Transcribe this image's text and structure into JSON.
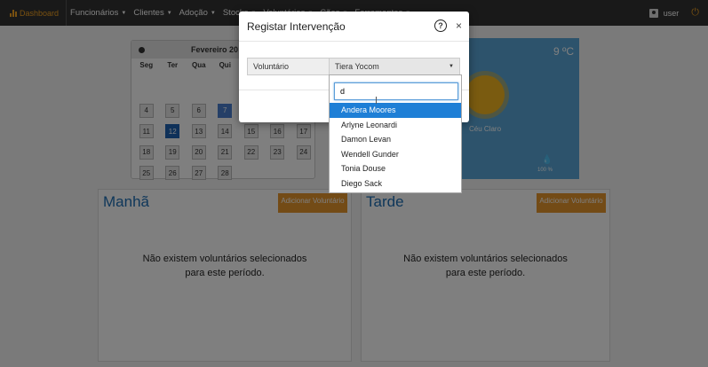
{
  "navbar": {
    "brand": "Dashboard",
    "items": [
      {
        "label": "Funcionários"
      },
      {
        "label": "Clientes"
      },
      {
        "label": "Adoção"
      },
      {
        "label": "Stocks"
      },
      {
        "label": "Voluntários"
      },
      {
        "label": "Cães"
      },
      {
        "label": "Ferramentas"
      }
    ],
    "user": "user"
  },
  "calendar": {
    "month": "Fevereiro 20",
    "weekdays": [
      "Seg",
      "Ter",
      "Qua",
      "Qui",
      "",
      "",
      ""
    ],
    "weeks": [
      [
        "4",
        "5",
        "6",
        "7",
        "",
        "",
        ""
      ],
      [
        "11",
        "12",
        "13",
        "14",
        "15",
        "16",
        "17"
      ],
      [
        "18",
        "19",
        "20",
        "21",
        "22",
        "23",
        "24"
      ],
      [
        "25",
        "26",
        "27",
        "28",
        "",
        "",
        ""
      ]
    ]
  },
  "weather": {
    "temp": "9 ºC",
    "desc": "Céu Claro",
    "humidity": "100 %"
  },
  "panels": {
    "morning": {
      "title": "Manhã",
      "button": "Adicionar Voluntário",
      "empty_line1": "Não existem voluntários selecionados",
      "empty_line2": "para este período."
    },
    "afternoon": {
      "title": "Tarde",
      "button": "Adicionar Voluntário",
      "empty_line1": "Não existem voluntários selecionados",
      "empty_line2": "para este período."
    }
  },
  "modal": {
    "title": "Registar Intervenção",
    "field_label": "Voluntário",
    "selected": "Tiera Yocom"
  },
  "dropdown": {
    "search_value": "d",
    "options": [
      "Andera Moores",
      "Arlyne Leonardi",
      "Damon Levan",
      "Wendell Gunder",
      "Tonia Douse",
      "Diego Sack"
    ],
    "selected_index": 0
  },
  "colors": {
    "accent": "#f0a020",
    "brand_blue": "#1e6fb5",
    "button_orange": "#e6962d",
    "highlight": "#1e7fd6"
  }
}
